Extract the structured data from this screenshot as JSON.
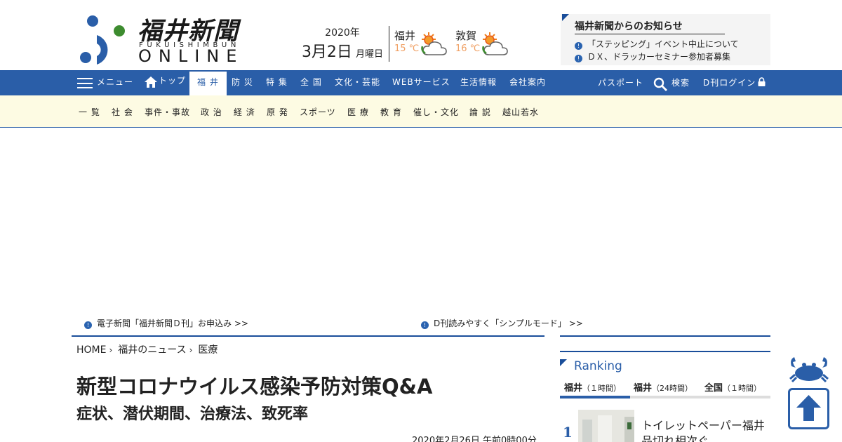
{
  "brand": {
    "name_main": "福井新聞",
    "name_romaji": "FUKUISHIMBUN",
    "name_online": "ONLINE",
    "color_blue": "#2a5ea8",
    "color_green": "#3d8c2f"
  },
  "date": {
    "year": "2020年",
    "day": "3月2日",
    "dow": "月曜日"
  },
  "weather": [
    {
      "city": "福井",
      "temp": "15 ℃",
      "icon": "sun-cloud-icon"
    },
    {
      "city": "敦賀",
      "temp": "16 ℃",
      "icon": "sun-cloud-icon"
    }
  ],
  "notice": {
    "title": "福井新聞からのお知らせ",
    "items": [
      "「ステッピング」イベント中止について",
      "ＤＸ、ドラッカーセミナー参加者募集"
    ]
  },
  "nav": {
    "menu": "メニュー",
    "top": "トップ",
    "items": [
      "福 井",
      "防 災",
      "特 集",
      "全 国",
      "文化・芸能",
      "WEBサービス",
      "生活情報",
      "会社案内"
    ],
    "passport": "パスポート",
    "search": "検索",
    "login": "D刊ログイン"
  },
  "subnav": [
    "一 覧",
    "社 会",
    "事件・事故",
    "政 治",
    "経 済",
    "原 発",
    "スポーツ",
    "医 療",
    "教 育",
    "催し・文化",
    "論 説",
    "越山若水"
  ],
  "promo": [
    "電子新聞「福井新聞Ｄ刊」お申込み >>",
    "D刊読みやすく「シンプルモード」 >>"
  ],
  "breadcrumb": [
    "HOME",
    "福井のニュース",
    "医療"
  ],
  "article": {
    "title": "新型コロナウイルス感染予防対策Q&A",
    "subtitle": "症状、潜伏期間、治療法、致死率",
    "date": "2020年2月26日 午前0時00分"
  },
  "ranking": {
    "title": "Ranking",
    "tabs": [
      {
        "label": "福井",
        "sub": "（１時間）"
      },
      {
        "label": "福井",
        "sub": "（24時間）"
      },
      {
        "label": "全国",
        "sub": "（１時間）"
      }
    ],
    "items": [
      {
        "rank": "1",
        "text": "トイレットペーパー福井品切れ相次ぐ"
      }
    ]
  }
}
